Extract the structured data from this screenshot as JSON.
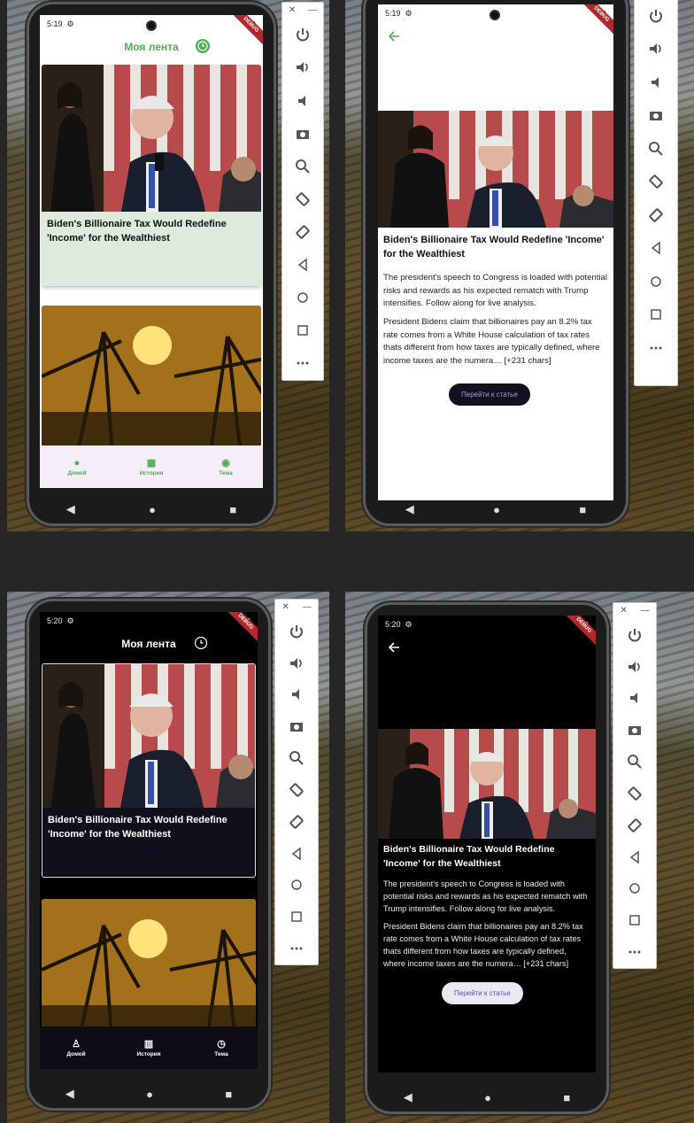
{
  "status": {
    "time_top": "5:19",
    "time_bottom": "5:20",
    "debug": "DEBUG"
  },
  "feed": {
    "title": "Моя лента",
    "articles": [
      {
        "title": "Biden's Billionaire Tax Would Redefine 'Income' for the Wealthiest"
      },
      {
        "title": ""
      }
    ]
  },
  "detail": {
    "title": "Biden's Billionaire Tax Would Redefine 'Income' for the Wealthiest",
    "description": "The president's speech to Congress is loaded with potential risks and rewards as his expected rematch with Trump intensifies. Follow along for live analysis.",
    "content": "President Bidens claim that billionaires pay an 8.2% tax rate comes from a White House calculation of tax rates thats different from how taxes are typically defined, where income taxes are the numera… [+231 chars]",
    "button": "Перейти к статье"
  },
  "nav": {
    "home": "Домой",
    "history": "История",
    "theme": "Тема"
  },
  "theme": {
    "accent": "#4caf50",
    "light_card": "#dcebdc",
    "dark_bg": "#000000",
    "dark_card": "#120f1c",
    "nav_light": "#f3eef8",
    "nav_dark": "#0f0c17"
  },
  "emulator_toolbar": {
    "window": [
      "close-icon",
      "minimize-icon"
    ],
    "buttons": [
      "power-icon",
      "volume-up-icon",
      "volume-down-icon",
      "camera-icon",
      "zoom-icon",
      "rotate-left-icon",
      "rotate-right-icon",
      "back-icon",
      "home-icon",
      "overview-icon",
      "more-icon"
    ]
  }
}
